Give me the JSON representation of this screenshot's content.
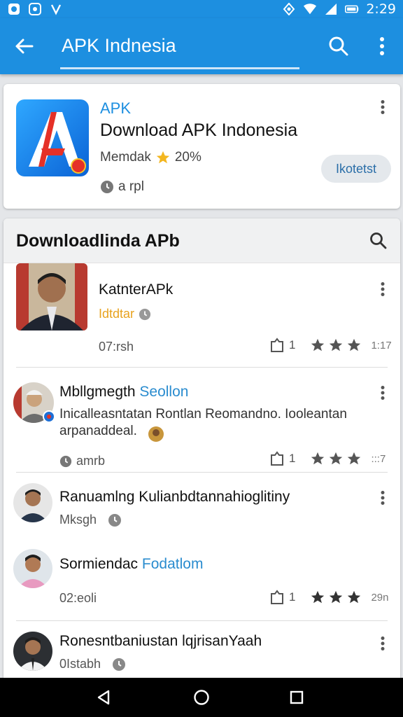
{
  "status_bar": {
    "time": "2:29"
  },
  "toolbar": {
    "title": "APK Indnesia"
  },
  "featured": {
    "tag": "APK",
    "title": "Download APK Indonesia",
    "meta_text": "Memdak",
    "rating_text": "20%",
    "sub_text": "a rpl",
    "button_label": "Ikotetst"
  },
  "list": {
    "header_title": "Downloadlinda APb",
    "items": [
      {
        "name": "KatnterAPk",
        "name_accent": "",
        "sub": "Idtdtar",
        "time": "07:rsh",
        "count": "1",
        "score": "1:17"
      },
      {
        "name": "Mbllgmegth",
        "name_accent": "Seollon",
        "desc": "Inicalleasntatan Rontlan Reomandno. Iooleantan arpanaddeal.",
        "sub": "amrb",
        "count": "1",
        "score": ":::7"
      },
      {
        "name": "Ranuamlng Kulianbdtannahioglitiny",
        "name_accent": "",
        "sub": "Mksgh"
      },
      {
        "name": "Sormiendac",
        "name_accent": "Fodatlom",
        "time": "02:eoli",
        "count": "1",
        "score": "29n"
      },
      {
        "name": "Ronesntbaniustan lqjrisanYaah",
        "name_accent": "",
        "sub": "0Istabh"
      }
    ]
  }
}
